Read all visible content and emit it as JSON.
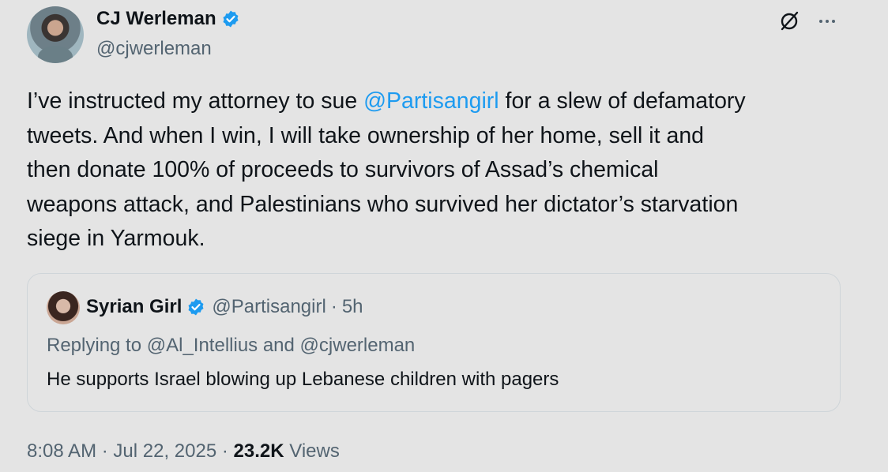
{
  "author": {
    "name": "CJ Werleman",
    "handle": "@cjwerleman"
  },
  "tweet": {
    "line1_pre": "I’ve instructed my attorney to sue ",
    "line1_mention": "@Partisangirl",
    "line1_post": " for a slew of defamatory",
    "line2": "tweets. And when I win, I will take ownership of her home, sell it and",
    "line3": "then donate 100% of proceeds to survivors of Assad’s chemical",
    "line4": "weapons attack, and Palestinians who survived her dictator’s starvation",
    "line5": "siege in Yarmouk."
  },
  "quote": {
    "name": "Syrian Girl",
    "handle": "@Partisangirl",
    "separator": "·",
    "time": "5h",
    "replying": "Replying to @Al_Intellius and @cjwerleman",
    "text": "He supports Israel blowing up Lebanese children with pagers"
  },
  "meta": {
    "time": "8:08 AM",
    "sep1": "·",
    "date": "Jul 22, 2025",
    "sep2": "·",
    "views_count": "23.2K",
    "views_label": "Views"
  },
  "icons": {
    "verified": "verified-badge-icon",
    "grok": "grok-icon",
    "more": "more-options-icon"
  },
  "colors": {
    "accent": "#1d9bf0",
    "text": "#0f1419",
    "muted": "#536471",
    "background": "#e4e4e4"
  }
}
